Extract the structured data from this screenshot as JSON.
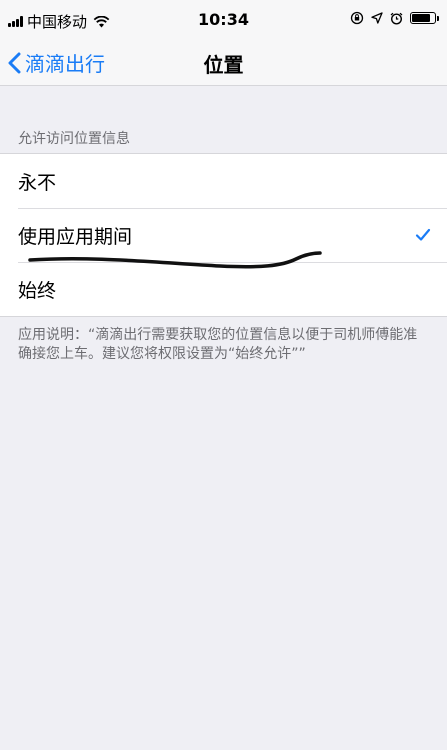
{
  "status_bar": {
    "carrier": "中国移动",
    "time": "10:34",
    "icons": [
      "signal-icon",
      "wifi-icon",
      "screen-rotation-lock-icon",
      "location-arrow-icon",
      "alarm-icon",
      "battery-icon"
    ],
    "battery_level": 0.8
  },
  "nav": {
    "back_label": "滴滴出行",
    "title": "位置"
  },
  "section_header": "允许访问位置信息",
  "options": [
    {
      "label": "永不",
      "selected": false
    },
    {
      "label": "使用应用期间",
      "selected": true
    },
    {
      "label": "始终",
      "selected": false
    }
  ],
  "footer_note": "应用说明：“滴滴出行需要获取您的位置信息以便于司机师傅能准确接您上车。建议您将权限设置为“始终允许””",
  "colors": {
    "accent": "#1a7cf6",
    "background": "#efeff4",
    "secondary_text": "#6d6d72"
  }
}
